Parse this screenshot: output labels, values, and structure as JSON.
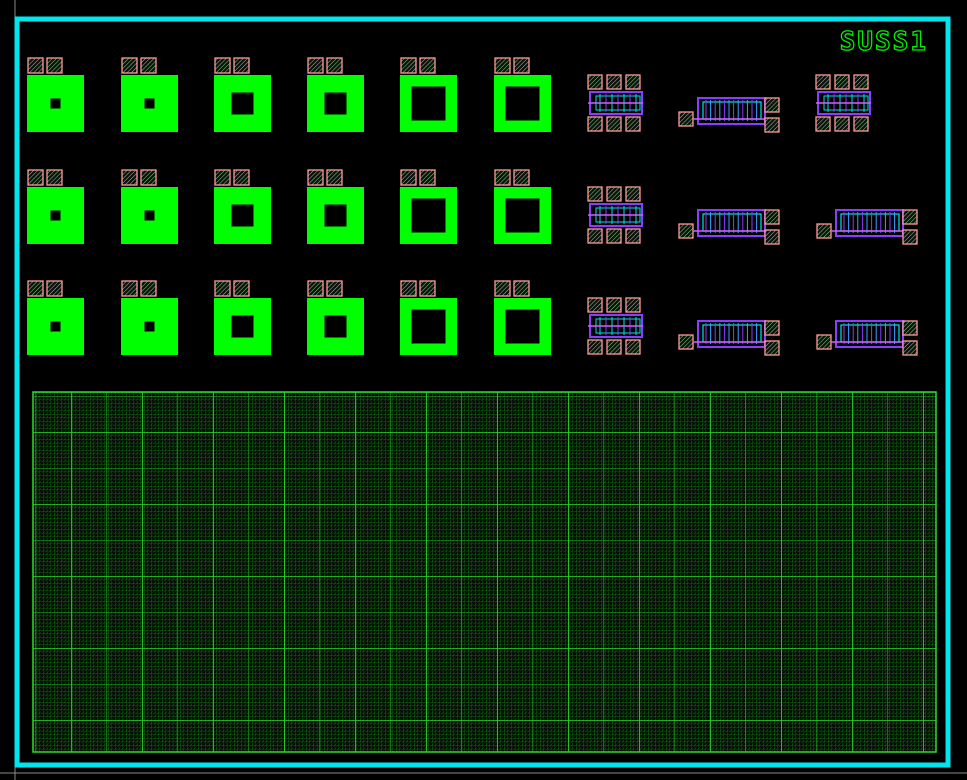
{
  "layout_view": {
    "chip_label": "SUSS1"
  },
  "colors": {
    "background": "#000000",
    "chip_border": "#00e5ee",
    "active_area": "#00ff00",
    "bond_pad": "#ff9a9a",
    "pad_hatch": "#7ad87a",
    "poly": "#8a3cff",
    "metal_cyan": "#00e5ee",
    "mesh_grid": "#1ea81e",
    "label_color": "#00ee00"
  },
  "devices": {
    "square_device_rows": 3,
    "square_device_columns": 6,
    "hole_sizes": [
      "small",
      "small",
      "medium",
      "medium",
      "large",
      "large"
    ],
    "transistor_columns": 3
  },
  "mesh_region": {
    "description_visible": false
  }
}
